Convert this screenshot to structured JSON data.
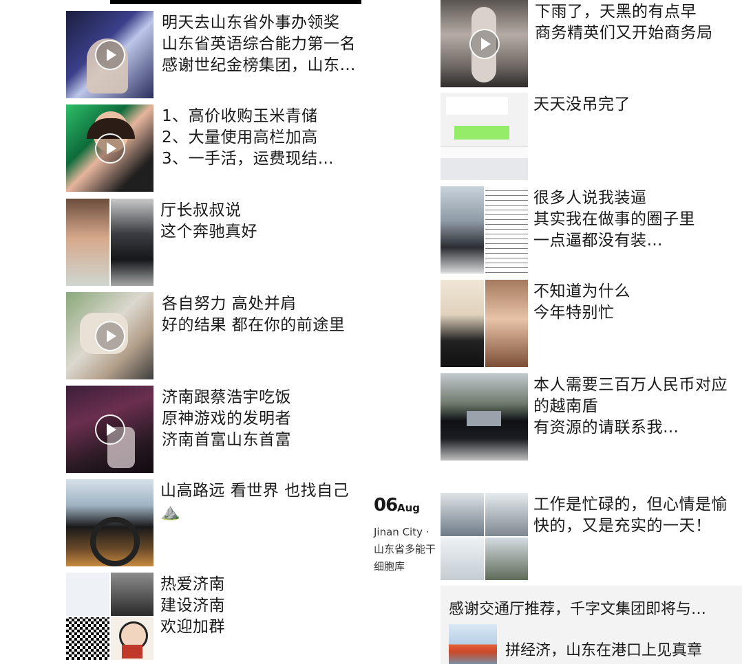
{
  "left_posts": [
    {
      "caption": "明天去山东省外事办领奖\n山东省英语综合能力第一名\n感谢世纪金榜集团，山东…",
      "has_video": true
    },
    {
      "caption": "1、高价收购玉米青储\n2、大量使用高栏加高\n3、一手活，运费现结…",
      "has_video": true
    },
    {
      "caption": "厅长叔叔说\n这个奔驰真好",
      "has_video": false
    },
    {
      "caption": "各自努力 高处并肩\n好的结果 都在你的前途里",
      "has_video": true
    },
    {
      "caption": "济南跟蔡浩宇吃饭\n原神游戏的发明者\n济南首富山东首富",
      "has_video": true
    },
    {
      "caption": "山高路远 看世界 也找自己\n⛰️",
      "has_video": false
    },
    {
      "caption": "热爱济南\n建设济南\n欢迎加群",
      "has_video": false
    }
  ],
  "right_posts": [
    {
      "caption": "下雨了，天黑的有点早\n商务精英们又开始商务局",
      "has_video": true
    },
    {
      "caption": "天天没吊完了",
      "has_video": false
    },
    {
      "caption": "很多人说我装逼\n其实我在做事的圈子里\n一点逼都没有装…",
      "has_video": false
    },
    {
      "caption": "不知道为什么\n今年特别忙",
      "has_video": false
    },
    {
      "caption": "本人需要三百万人民币对应\n的越南盾\n有资源的请联系我…",
      "has_video": false
    },
    {
      "caption": "工作是忙碌的，但心情是愉\n快的，又是充实的一天！",
      "has_video": false
    }
  ],
  "date_group": {
    "day": "06",
    "month": "Aug",
    "location": "Jinan City · 山东省多能干细胞库"
  },
  "shared_link": {
    "title": "感谢交通厅推荐，千字文集团即将与…",
    "article": "拼经济，山东在港口上见真章"
  },
  "colors": {
    "background": "#ffffff",
    "text": "#1a1a1a",
    "share_bg": "#f3f3f3"
  }
}
